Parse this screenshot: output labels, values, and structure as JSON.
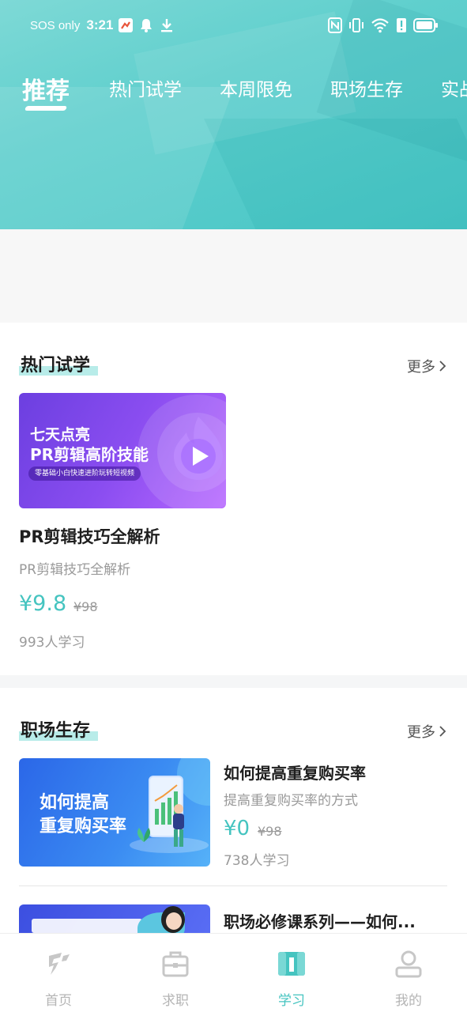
{
  "status_bar": {
    "carrier": "SOS only",
    "time": "3:21"
  },
  "tabs": [
    {
      "label": "推荐",
      "active": true
    },
    {
      "label": "热门试学",
      "active": false
    },
    {
      "label": "本周限免",
      "active": false
    },
    {
      "label": "职场生存",
      "active": false
    },
    {
      "label": "实战",
      "active": false
    }
  ],
  "section_hot": {
    "title": "热门试学",
    "more": "更多",
    "card": {
      "thumb_line1": "七天点亮",
      "thumb_line2": "PR剪辑高阶技能",
      "thumb_tag": "零基础小白快速进阶玩转短视频",
      "title": "PR剪辑技巧全解析",
      "subtitle": "PR剪辑技巧全解析",
      "price": "¥9.8",
      "original_price": "¥98",
      "learners": "993人学习"
    }
  },
  "section_career": {
    "title": "职场生存",
    "more": "更多",
    "items": [
      {
        "thumb_line1": "如何提高",
        "thumb_line2": "重复购买率",
        "title": "如何提高重复购买率",
        "subtitle": "提高重复购买率的方式",
        "price": "¥0",
        "original_price": "¥98",
        "learners": "738人学习"
      },
      {
        "title": "职场必修课系列——如何..."
      }
    ]
  },
  "bottom_nav": [
    {
      "label": "首页",
      "icon": "home-icon",
      "active": false
    },
    {
      "label": "求职",
      "icon": "briefcase-icon",
      "active": false
    },
    {
      "label": "学习",
      "icon": "book-icon",
      "active": true
    },
    {
      "label": "我的",
      "icon": "user-icon",
      "active": false
    }
  ],
  "colors": {
    "accent": "#45c4c0",
    "header": "#5fcfcd",
    "inactive": "#b5b5b5"
  }
}
